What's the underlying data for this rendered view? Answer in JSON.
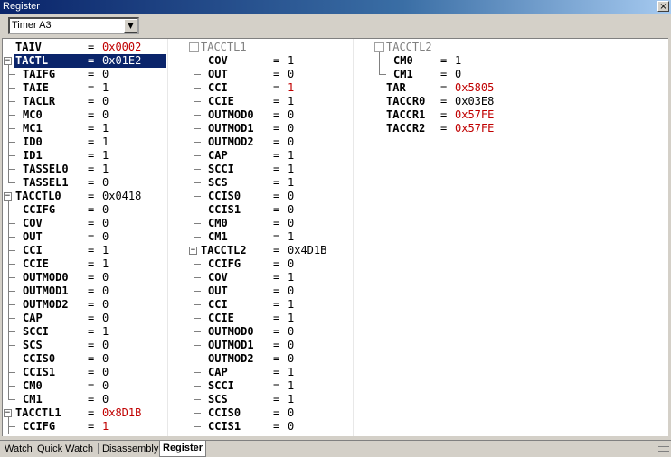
{
  "window": {
    "title": "Register",
    "close_glyph": "×"
  },
  "toolbar": {
    "combo_value": "Timer A3",
    "combo_arrow": "▼"
  },
  "columns": [
    {
      "rows": [
        {
          "name": "TAIV",
          "value": "0x0002",
          "changed": true,
          "kind": "top"
        },
        {
          "name": "TACTL",
          "value": "0x01E2",
          "changed": false,
          "kind": "group",
          "selected": true
        },
        {
          "name": "TAIFG",
          "value": "0",
          "changed": false,
          "kind": "child"
        },
        {
          "name": "TAIE",
          "value": "1",
          "changed": false,
          "kind": "child"
        },
        {
          "name": "TACLR",
          "value": "0",
          "changed": false,
          "kind": "child"
        },
        {
          "name": "MC0",
          "value": "0",
          "changed": false,
          "kind": "child"
        },
        {
          "name": "MC1",
          "value": "1",
          "changed": false,
          "kind": "child"
        },
        {
          "name": "ID0",
          "value": "1",
          "changed": false,
          "kind": "child"
        },
        {
          "name": "ID1",
          "value": "1",
          "changed": false,
          "kind": "child"
        },
        {
          "name": "TASSEL0",
          "value": "1",
          "changed": false,
          "kind": "child"
        },
        {
          "name": "TASSEL1",
          "value": "0",
          "changed": false,
          "kind": "child",
          "last": true
        },
        {
          "name": "TACCTL0",
          "value": "0x0418",
          "changed": false,
          "kind": "group"
        },
        {
          "name": "CCIFG",
          "value": "0",
          "changed": false,
          "kind": "child"
        },
        {
          "name": "COV",
          "value": "0",
          "changed": false,
          "kind": "child"
        },
        {
          "name": "OUT",
          "value": "0",
          "changed": false,
          "kind": "child"
        },
        {
          "name": "CCI",
          "value": "1",
          "changed": false,
          "kind": "child"
        },
        {
          "name": "CCIE",
          "value": "1",
          "changed": false,
          "kind": "child"
        },
        {
          "name": "OUTMOD0",
          "value": "0",
          "changed": false,
          "kind": "child"
        },
        {
          "name": "OUTMOD1",
          "value": "0",
          "changed": false,
          "kind": "child"
        },
        {
          "name": "OUTMOD2",
          "value": "0",
          "changed": false,
          "kind": "child"
        },
        {
          "name": "CAP",
          "value": "0",
          "changed": false,
          "kind": "child"
        },
        {
          "name": "SCCI",
          "value": "1",
          "changed": false,
          "kind": "child"
        },
        {
          "name": "SCS",
          "value": "0",
          "changed": false,
          "kind": "child"
        },
        {
          "name": "CCIS0",
          "value": "0",
          "changed": false,
          "kind": "child"
        },
        {
          "name": "CCIS1",
          "value": "0",
          "changed": false,
          "kind": "child"
        },
        {
          "name": "CM0",
          "value": "0",
          "changed": false,
          "kind": "child"
        },
        {
          "name": "CM1",
          "value": "0",
          "changed": false,
          "kind": "child",
          "last": true
        },
        {
          "name": "TACCTL1",
          "value": "0x8D1B",
          "changed": true,
          "kind": "group"
        },
        {
          "name": "CCIFG",
          "value": "1",
          "changed": true,
          "kind": "child"
        }
      ]
    },
    {
      "rows": [
        {
          "name": "TACCTL1",
          "value": "",
          "changed": false,
          "kind": "header"
        },
        {
          "name": "COV",
          "value": "1",
          "changed": false,
          "kind": "child"
        },
        {
          "name": "OUT",
          "value": "0",
          "changed": false,
          "kind": "child"
        },
        {
          "name": "CCI",
          "value": "1",
          "changed": true,
          "kind": "child"
        },
        {
          "name": "CCIE",
          "value": "1",
          "changed": false,
          "kind": "child"
        },
        {
          "name": "OUTMOD0",
          "value": "0",
          "changed": false,
          "kind": "child"
        },
        {
          "name": "OUTMOD1",
          "value": "0",
          "changed": false,
          "kind": "child"
        },
        {
          "name": "OUTMOD2",
          "value": "0",
          "changed": false,
          "kind": "child"
        },
        {
          "name": "CAP",
          "value": "1",
          "changed": false,
          "kind": "child"
        },
        {
          "name": "SCCI",
          "value": "1",
          "changed": false,
          "kind": "child"
        },
        {
          "name": "SCS",
          "value": "1",
          "changed": false,
          "kind": "child"
        },
        {
          "name": "CCIS0",
          "value": "0",
          "changed": false,
          "kind": "child"
        },
        {
          "name": "CCIS1",
          "value": "0",
          "changed": false,
          "kind": "child"
        },
        {
          "name": "CM0",
          "value": "0",
          "changed": false,
          "kind": "child"
        },
        {
          "name": "CM1",
          "value": "1",
          "changed": false,
          "kind": "child",
          "last": true
        },
        {
          "name": "TACCTL2",
          "value": "0x4D1B",
          "changed": false,
          "kind": "group"
        },
        {
          "name": "CCIFG",
          "value": "0",
          "changed": false,
          "kind": "child"
        },
        {
          "name": "COV",
          "value": "1",
          "changed": false,
          "kind": "child"
        },
        {
          "name": "OUT",
          "value": "0",
          "changed": false,
          "kind": "child"
        },
        {
          "name": "CCI",
          "value": "1",
          "changed": false,
          "kind": "child"
        },
        {
          "name": "CCIE",
          "value": "1",
          "changed": false,
          "kind": "child"
        },
        {
          "name": "OUTMOD0",
          "value": "0",
          "changed": false,
          "kind": "child"
        },
        {
          "name": "OUTMOD1",
          "value": "0",
          "changed": false,
          "kind": "child"
        },
        {
          "name": "OUTMOD2",
          "value": "0",
          "changed": false,
          "kind": "child"
        },
        {
          "name": "CAP",
          "value": "1",
          "changed": false,
          "kind": "child"
        },
        {
          "name": "SCCI",
          "value": "1",
          "changed": false,
          "kind": "child"
        },
        {
          "name": "SCS",
          "value": "1",
          "changed": false,
          "kind": "child"
        },
        {
          "name": "CCIS0",
          "value": "0",
          "changed": false,
          "kind": "child"
        },
        {
          "name": "CCIS1",
          "value": "0",
          "changed": false,
          "kind": "child"
        }
      ]
    },
    {
      "rows": [
        {
          "name": "TACCTL2",
          "value": "",
          "changed": false,
          "kind": "header"
        },
        {
          "name": "CM0",
          "value": "1",
          "changed": false,
          "kind": "child"
        },
        {
          "name": "CM1",
          "value": "0",
          "changed": false,
          "kind": "child",
          "last": true
        },
        {
          "name": "TAR",
          "value": "0x5805",
          "changed": true,
          "kind": "top"
        },
        {
          "name": "TACCR0",
          "value": "0x03E8",
          "changed": false,
          "kind": "top"
        },
        {
          "name": "TACCR1",
          "value": "0x57FE",
          "changed": true,
          "kind": "top"
        },
        {
          "name": "TACCR2",
          "value": "0x57FE",
          "changed": true,
          "kind": "top"
        }
      ]
    }
  ],
  "tabs": [
    {
      "label": "Watch",
      "active": false
    },
    {
      "label": "Quick Watch",
      "active": false
    },
    {
      "label": "Disassembly",
      "active": false
    },
    {
      "label": "Register",
      "active": true
    }
  ],
  "colors": {
    "changed": "#c00000",
    "selection": "#0a246a",
    "tree_line": "#808080"
  }
}
